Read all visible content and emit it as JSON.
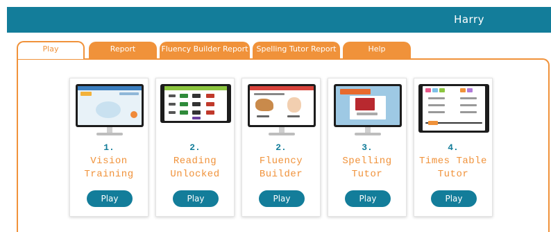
{
  "header": {
    "user_name": "Harry"
  },
  "tabs": [
    {
      "label": "Play",
      "active": true
    },
    {
      "label": "Report",
      "active": false
    },
    {
      "label": "Fluency Builder Report",
      "active": false
    },
    {
      "label": "Spelling Tutor Report",
      "active": false
    },
    {
      "label": "Help",
      "active": false
    }
  ],
  "cards": [
    {
      "number": "1.",
      "title_line1": "Vision",
      "title_line2": "Training",
      "play_label": "Play"
    },
    {
      "number": "2.",
      "title_line1": "Reading",
      "title_line2": "Unlocked",
      "play_label": "Play"
    },
    {
      "number": "2.",
      "title_line1": "Fluency",
      "title_line2": "Builder",
      "play_label": "Play"
    },
    {
      "number": "3.",
      "title_line1": "Spelling",
      "title_line2": "Tutor",
      "play_label": "Play"
    },
    {
      "number": "4.",
      "title_line1": "Times Table",
      "title_line2": "Tutor",
      "play_label": "Play"
    }
  ],
  "colors": {
    "brand_teal": "#137d9a",
    "accent_orange": "#f0923a"
  }
}
